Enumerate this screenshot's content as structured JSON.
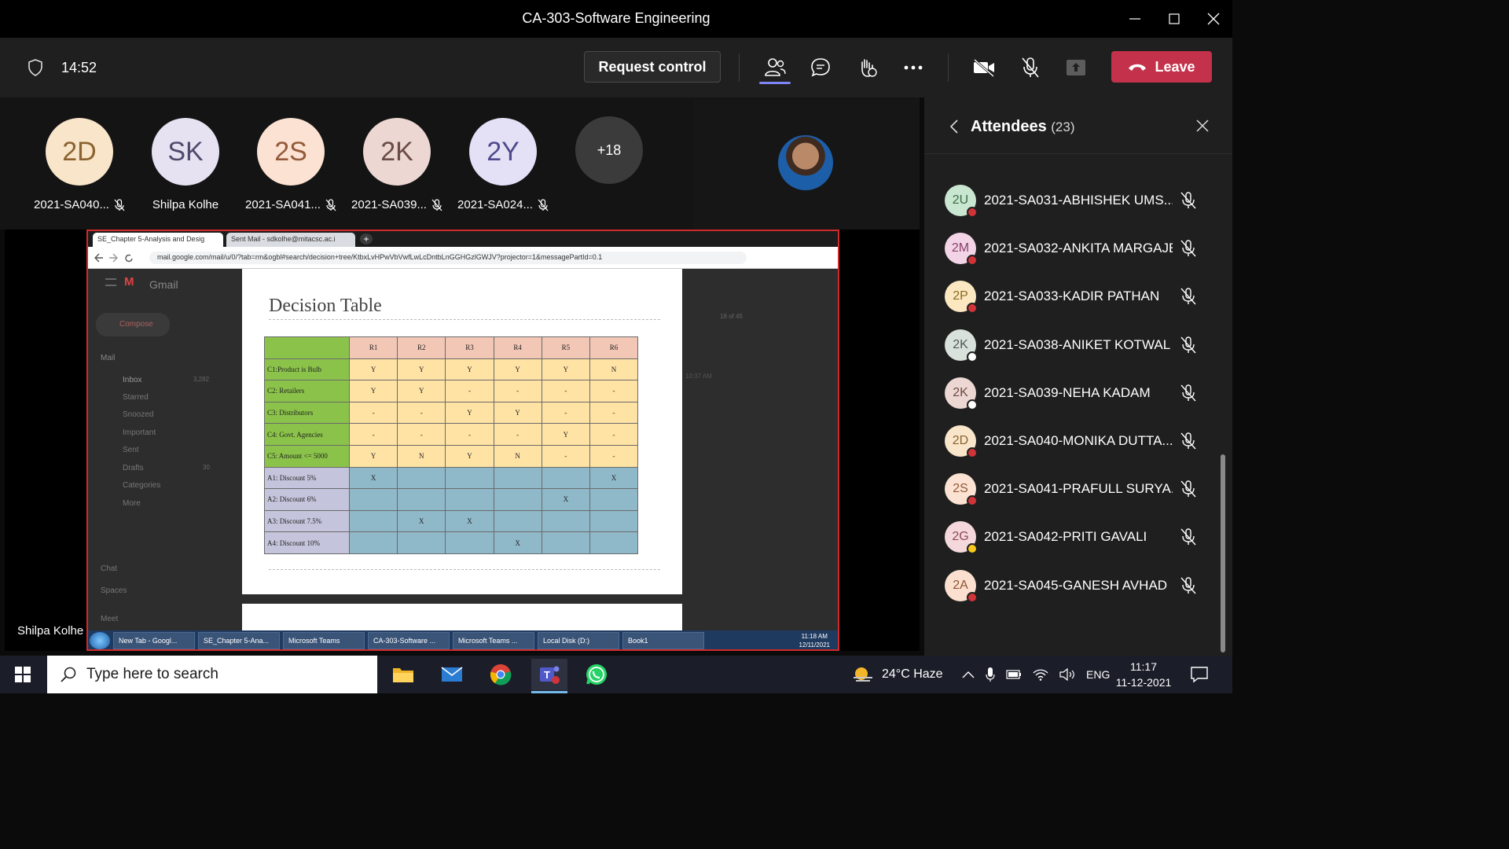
{
  "window": {
    "title": "CA-303-Software Engineering"
  },
  "meeting": {
    "timer": "14:52",
    "request_control": "Request control",
    "leave": "Leave"
  },
  "strip": {
    "participants": [
      {
        "initials": "2D",
        "name": "2021-SA040...",
        "muted": true
      },
      {
        "initials": "SK",
        "name": "Shilpa Kolhe",
        "muted": false
      },
      {
        "initials": "2S",
        "name": "2021-SA041...",
        "muted": true
      },
      {
        "initials": "2K",
        "name": "2021-SA039...",
        "muted": true
      },
      {
        "initials": "2Y",
        "name": "2021-SA024...",
        "muted": true
      }
    ],
    "more": "+18",
    "sharer_name": "Shilpa Kolhe"
  },
  "browser": {
    "tab1": "SE_Chapter 5-Analysis and Desig",
    "tab2": "Sent Mail - sdkolhe@mitacsc.ac.i",
    "url": "mail.google.com/mail/u/0/?tab=rm&ogbl#search/decision+tree/KtbxLvHPwVbVwfLwLcDntbLnGGHGzlGWJV?projector=1&messagePartId=0.1"
  },
  "gmail": {
    "brand": "Gmail",
    "compose": "Compose",
    "mail_header": "Mail",
    "nav": [
      "Inbox",
      "Starred",
      "Snoozed",
      "Important",
      "Sent",
      "Drafts",
      "Categories",
      "More"
    ],
    "inbox_count": "3,282",
    "drafts_count": "30",
    "chat": "Chat",
    "spaces": "Spaces",
    "meet": "Meet",
    "pager": "18 of 45",
    "time": "10:37 AM"
  },
  "document": {
    "title": "Decision Table",
    "columns": [
      "R1",
      "R2",
      "R3",
      "R4",
      "R5",
      "R6"
    ],
    "conditions": [
      {
        "label": "C1:Product is Bulb",
        "cells": [
          "Y",
          "Y",
          "Y",
          "Y",
          "Y",
          "N"
        ]
      },
      {
        "label": "C2: Retailers",
        "cells": [
          "Y",
          "Y",
          "-",
          "-",
          "-",
          "-"
        ]
      },
      {
        "label": "C3: Distributors",
        "cells": [
          "-",
          "-",
          "Y",
          "Y",
          "-",
          "-"
        ]
      },
      {
        "label": "C4: Govt. Agencies",
        "cells": [
          "-",
          "-",
          "-",
          "-",
          "Y",
          "-"
        ]
      },
      {
        "label": "C5: Amount <= 5000",
        "cells": [
          "Y",
          "N",
          "Y",
          "N",
          "-",
          "-"
        ]
      }
    ],
    "actions": [
      {
        "label": "A1: Discount 5%",
        "cells": [
          "X",
          "",
          "",
          "",
          "",
          "X"
        ]
      },
      {
        "label": "A2: Discount 6%",
        "cells": [
          "",
          "",
          "",
          "",
          "X",
          ""
        ]
      },
      {
        "label": "A3: Discount 7.5%",
        "cells": [
          "",
          "X",
          "X",
          "",
          "",
          ""
        ]
      },
      {
        "label": "A4: Discount 10%",
        "cells": [
          "",
          "",
          "",
          "X",
          "",
          ""
        ]
      }
    ]
  },
  "inner_taskbar": {
    "items": [
      "New Tab - Googl...",
      "SE_Chapter 5-Ana...",
      "Microsoft Teams",
      "CA-303-Software ...",
      "Microsoft Teams ...",
      "Local Disk (D:)",
      "Book1"
    ],
    "time": "11:18 AM",
    "date": "12/11/2021"
  },
  "attendees_panel": {
    "title": "Attendees",
    "count": "(23)",
    "list": [
      {
        "initials": "2U",
        "name": "2021-SA031-ABHISHEK UMS...",
        "avatar": "#c9e6d0",
        "fg": "#3a6b45",
        "status": "#d13438"
      },
      {
        "initials": "2M",
        "name": "2021-SA032-ANKITA MARGAJE",
        "avatar": "#f2d4e6",
        "fg": "#8a3f6b",
        "status": "#d13438"
      },
      {
        "initials": "2P",
        "name": "2021-SA033-KADIR PATHAN",
        "avatar": "#fbe8c0",
        "fg": "#8a6a1f",
        "status": "#d13438"
      },
      {
        "initials": "2K",
        "name": "2021-SA038-ANIKET KOTWAL",
        "avatar": "#d9e1dc",
        "fg": "#4d5c53",
        "status": "#ffffff"
      },
      {
        "initials": "2K",
        "name": "2021-SA039-NEHA KADAM",
        "avatar": "#ecd7d3",
        "fg": "#6b4b45",
        "status": "#ffffff"
      },
      {
        "initials": "2D",
        "name": "2021-SA040-MONIKA DUTTA...",
        "avatar": "#f9e5c9",
        "fg": "#8a6330",
        "status": "#d13438"
      },
      {
        "initials": "2S",
        "name": "2021-SA041-PRAFULL SURYA...",
        "avatar": "#fbe2d2",
        "fg": "#93593a",
        "status": "#d13438"
      },
      {
        "initials": "2G",
        "name": "2021-SA042-PRITI GAVALI",
        "avatar": "#f5d8dc",
        "fg": "#8c4855",
        "status": "#f8c81c"
      },
      {
        "initials": "2A",
        "name": "2021-SA045-GANESH AVHAD",
        "avatar": "#fbe0d0",
        "fg": "#8f5436",
        "status": "#d13438"
      }
    ]
  },
  "taskbar": {
    "search_placeholder": "Type here to search",
    "weather": "24°C  Haze",
    "lang": "ENG",
    "time": "11:17",
    "date": "11-12-2021"
  },
  "colors": {
    "leave": "#c4314b",
    "accent": "#7f85f5",
    "table_condition_label": "#8bc34a",
    "table_header": "#f3c7b6",
    "table_condition_cell": "#ffe3a5",
    "table_action_label": "#c4c4dc",
    "table_action_cell": "#8fb8c9"
  }
}
